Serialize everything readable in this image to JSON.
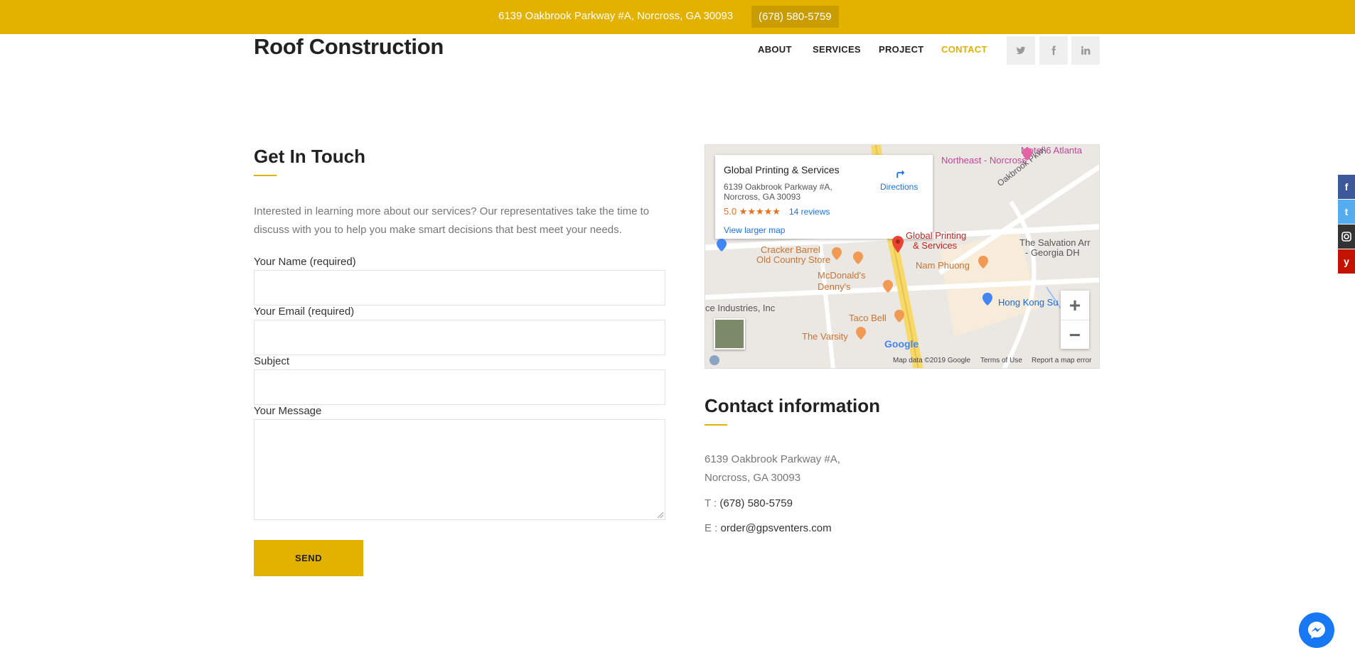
{
  "topbar": {
    "address": "6139 Oakbrook Parkway #A, Norcross, GA 30093",
    "phone": "(678) 580-5759"
  },
  "header": {
    "logo": "Roof Construction",
    "nav": [
      {
        "label": "ABOUT"
      },
      {
        "label": "SERVICES"
      },
      {
        "label": "PROJECT"
      },
      {
        "label": "CONTACT",
        "active": true
      }
    ],
    "social": [
      "twitter-icon",
      "facebook-icon",
      "linkedin-icon"
    ]
  },
  "form": {
    "title": "Get In Touch",
    "intro": "Interested in learning more about our services? Our representatives take the time to discuss with you to help you make smart decisions that best meet your needs.",
    "fields": [
      {
        "label": "Your Name (required)",
        "value": ""
      },
      {
        "label": "Your Email (required)",
        "value": ""
      },
      {
        "label": "Subject",
        "value": ""
      },
      {
        "label": "Your Message",
        "value": ""
      }
    ],
    "submit": "SEND"
  },
  "map": {
    "place_name": "Global Printing & Services",
    "address_line1": "6139 Oakbrook Parkway #A,",
    "address_line2": "Norcross, GA 30093",
    "rating": "5.0 ★★★★★",
    "reviews": "14 reviews",
    "directions": "Directions",
    "larger_map": "View larger map",
    "labels": {
      "motel": "Motel 6 Atlanta",
      "northeast": "Northeast - Norcross",
      "oakbrook": "Oakbrook Pkwy",
      "pin_label1": "Global Printing",
      "pin_label2": "& Services",
      "salvation1": "The Salvation Arr",
      "salvation2": "- Georgia DH",
      "cracker1": "Cracker Barrel",
      "cracker2": "Old Country Store",
      "mcdonalds": "McDonald's",
      "dennys": "Denny's",
      "namphuong": "Nam Phuong",
      "hongkong": "Hong Kong Su",
      "industries": "ce Industries, Inc",
      "tacobell": "Taco Bell",
      "varsity": "The Varsity",
      "google": "Google"
    },
    "footer": {
      "data": "Map data ©2019 Google",
      "terms": "Terms of Use",
      "report": "Report a map error"
    },
    "zoom_in": "+",
    "zoom_out": "−"
  },
  "contact": {
    "title": "Contact information",
    "address_line1": "6139 Oakbrook Parkway #A,",
    "address_line2": "Norcross, GA 30093",
    "phone_prefix": "T : ",
    "phone": "(678) 580-5759",
    "email_prefix": "E : ",
    "email": "order@gpsventers.com"
  },
  "side_share": [
    {
      "icon": "facebook-icon",
      "color": "#3b5998"
    },
    {
      "icon": "twitter-icon",
      "color": "#55acee"
    },
    {
      "icon": "instagram-icon",
      "color": "#333333"
    },
    {
      "icon": "yelp-icon",
      "color": "#c41200"
    }
  ],
  "colors": {
    "accent": "#e3b100",
    "accent_dark": "#c99c00"
  }
}
